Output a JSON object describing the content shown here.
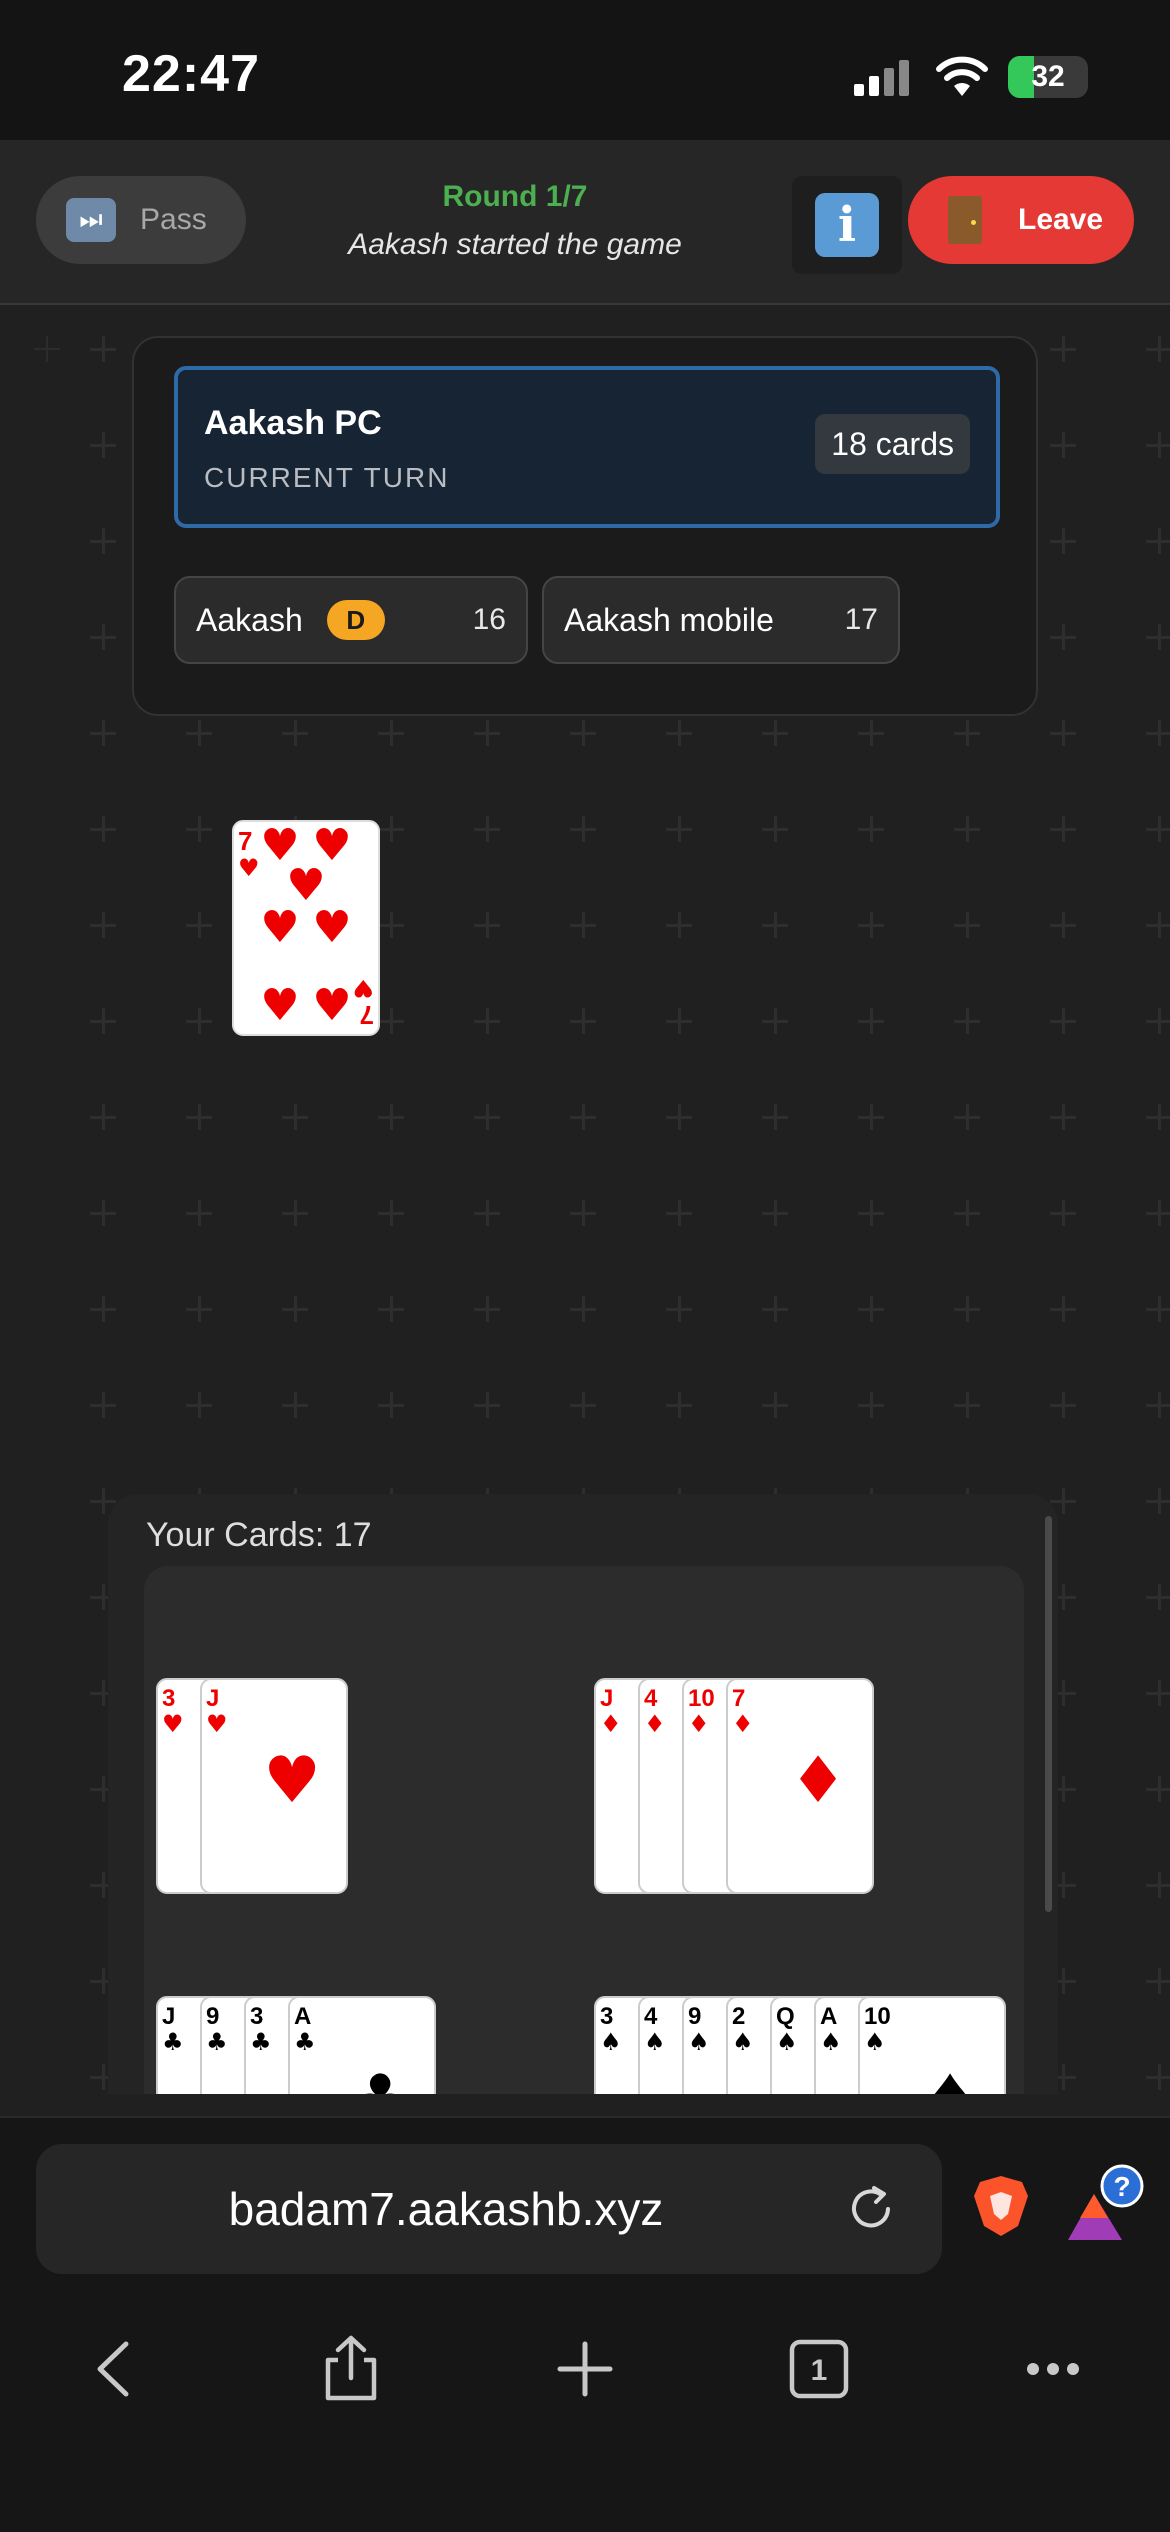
{
  "status_bar": {
    "time": "22:47",
    "battery": "32",
    "battery_level": 0.32,
    "battery_color": "#34c759"
  },
  "header": {
    "pass_label": "Pass",
    "round": "Round 1/7",
    "subtitle": "Aakash started the game",
    "info_icon_glyph": "i",
    "leave_label": "Leave"
  },
  "current_turn": {
    "name": "Aakash PC",
    "label": "CURRENT TURN",
    "cards": "18 cards"
  },
  "players": [
    {
      "name": "Aakash",
      "badge": "D",
      "count": "16"
    },
    {
      "name": "Aakash mobile",
      "count": "17"
    }
  ],
  "table": {
    "card": {
      "rank": "7",
      "suit": "hearts"
    }
  },
  "hand": {
    "title": "Your Cards: 17",
    "groups": [
      {
        "suit": "hearts",
        "cards": [
          "3",
          "J"
        ]
      },
      {
        "suit": "diamonds",
        "cards": [
          "J",
          "4",
          "10",
          "7"
        ]
      },
      {
        "suit": "clubs",
        "cards": [
          "J",
          "9",
          "3",
          "A"
        ]
      },
      {
        "suit": "spades",
        "cards": [
          "3",
          "4",
          "9",
          "2",
          "Q",
          "A",
          "10"
        ]
      }
    ]
  },
  "browser": {
    "url": "badam7.aakashb.xyz",
    "tab_count": "1",
    "help_badge": "?"
  }
}
